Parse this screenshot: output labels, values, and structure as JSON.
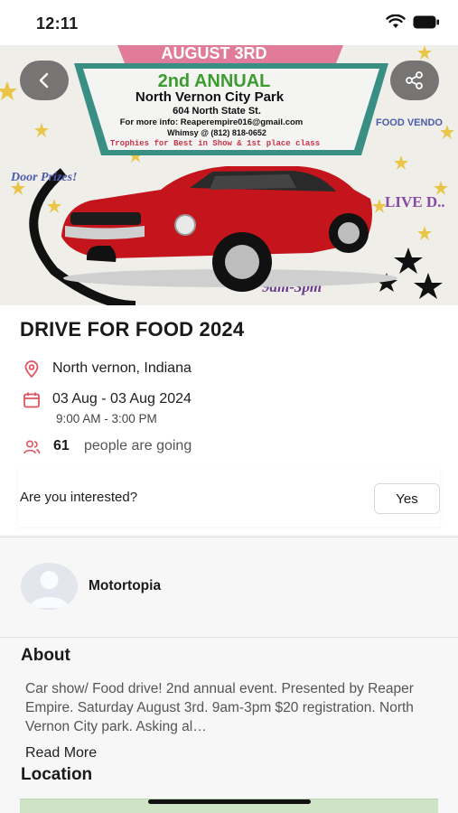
{
  "status_bar": {
    "time": "12:11"
  },
  "poster": {
    "date_banner": "AUGUST 3RD",
    "edition": "2nd ANNUAL",
    "venue": "North Vernon City Park",
    "address": "604 North State St.",
    "info": "For more info: Reaperempire016@gmail.com",
    "phone": "Whimsy @ (812) 818-0652",
    "trophies": "Trophies for Best in Show & 1st place class",
    "door_prizes": "Door Prizes!",
    "food_vendors": "FOOD VENDO",
    "live_dj": "LIVE D..",
    "hours": "9am-3pm"
  },
  "event": {
    "title": "DRIVE FOR FOOD 2024",
    "location": "North vernon, Indiana",
    "date_range": "03 Aug - 03 Aug 2024",
    "time_range": "9:00 AM - 3:00 PM",
    "going_count": "61",
    "going_label": "people are going"
  },
  "interest": {
    "question": "Are you interested?",
    "yes_label": "Yes"
  },
  "organizer": {
    "name": "Motortopia"
  },
  "about": {
    "heading": "About",
    "text": "Car show/ Food drive! 2nd annual event. Presented by Reaper Empire. Saturday August 3rd. 9am-3pm $20 registration. North Vernon City park. Asking al…",
    "read_more": "Read More"
  },
  "location": {
    "heading": "Location"
  },
  "colors": {
    "accent": "#e0525f",
    "car_red": "#c4141c",
    "poster_teal": "#3a8f84"
  },
  "icons": [
    "back-arrow-icon",
    "share-icon",
    "location-pin-icon",
    "calendar-icon",
    "people-icon",
    "wifi-icon",
    "battery-icon",
    "avatar-icon"
  ]
}
